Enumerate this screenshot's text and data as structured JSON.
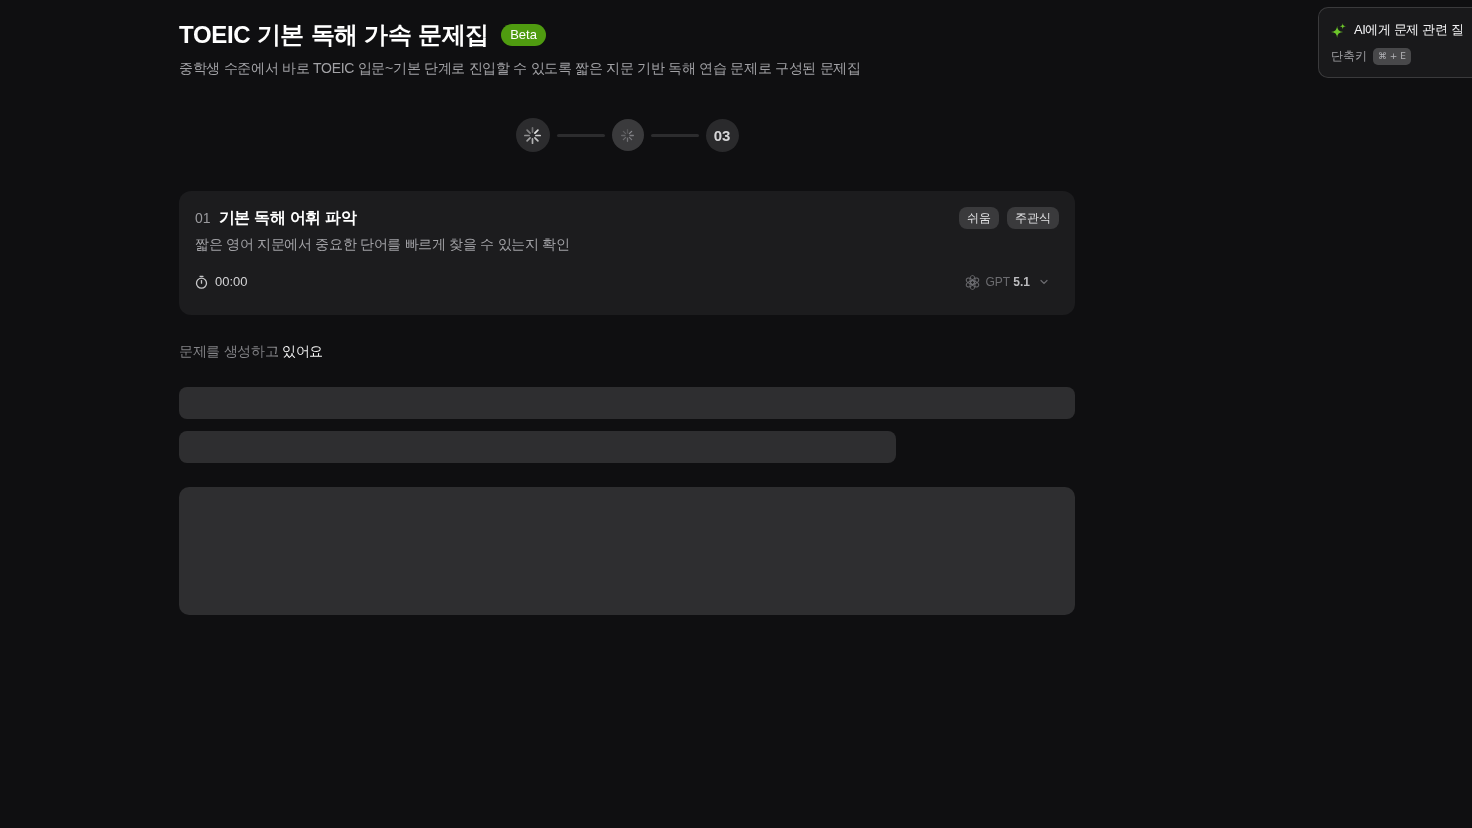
{
  "header": {
    "title": "TOEIC 기본 독해 가속 문제집",
    "badge": "Beta",
    "subtitle": "중학생 수준에서 바로 TOEIC 입문~기본 단계로 진입할 수 있도록 짧은 지문 기반 독해 연습 문제로 구성된 문제집"
  },
  "steps": [
    {
      "kind": "spinner",
      "active": true
    },
    {
      "kind": "spinner",
      "active": false
    },
    {
      "kind": "number",
      "label": "03",
      "active": false
    }
  ],
  "question": {
    "number": "01",
    "title": "기본 독해 어휘 파악",
    "tags": [
      "쉬움",
      "주관식"
    ],
    "description": "짧은 영어 지문에서 중요한 단어를 빠르게 찾을 수 있는지 확인",
    "timer": "00:00",
    "model": "GPT **5.1**"
  },
  "status": {
    "text": "문제를 생성하고 있어요"
  },
  "ai_panel": {
    "label": "AI에게 문제 관련 질",
    "shortcut_label": "단축키",
    "shortcut_keys": "⌘ + E"
  }
}
